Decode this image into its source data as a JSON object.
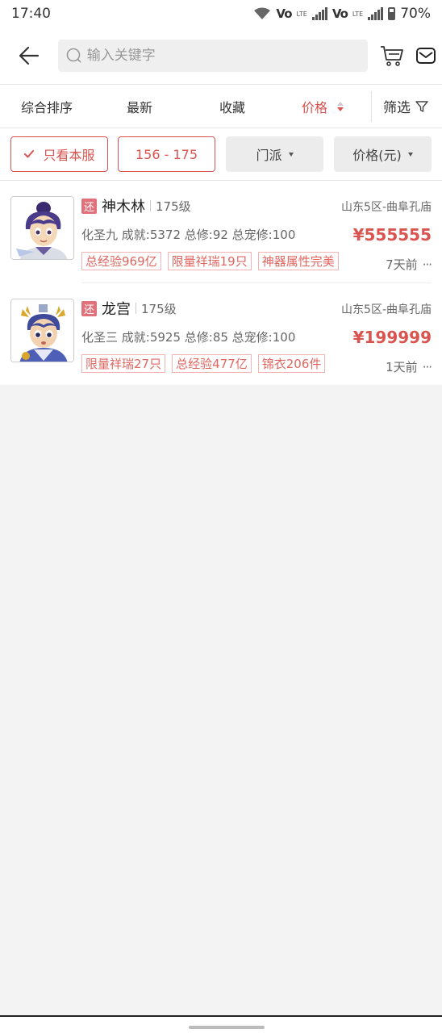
{
  "status_bar": {
    "time": "17:40",
    "volte_1": "Vo",
    "volte_2": "Vo",
    "lte_1": "LTE",
    "lte_2": "LTE",
    "battery": "70%"
  },
  "header": {
    "search_placeholder": "输入关键字"
  },
  "sort_bar": {
    "items": [
      "综合排序",
      "最新",
      "收藏",
      "价格"
    ],
    "active_index": 3,
    "filter_label": "筛选"
  },
  "filters": {
    "server_only": "只看本服",
    "level_range": "156 - 175",
    "sect": "门派",
    "price": "价格(元)"
  },
  "listings": [
    {
      "tag": "还",
      "name": "神木林",
      "level": "175级",
      "server": "山东5区-曲阜孔庙",
      "stats": "化圣九 成就:5372 总修:92 总宠修:100",
      "price": "¥555555",
      "tags": [
        "总经验969亿",
        "限量祥瑞19只",
        "神器属性完美"
      ],
      "time": "7天前"
    },
    {
      "tag": "还",
      "name": "龙宫",
      "level": "175级",
      "server": "山东5区-曲阜孔庙",
      "stats": "化圣三 成就:5925 总修:85 总宠修:100",
      "price": "¥199999",
      "tags": [
        "限量祥瑞27只",
        "总经验477亿",
        "锦衣206件"
      ],
      "time": "1天前"
    }
  ],
  "colors": {
    "accent": "#d9534f",
    "tag_border": "#f3b3b0"
  }
}
